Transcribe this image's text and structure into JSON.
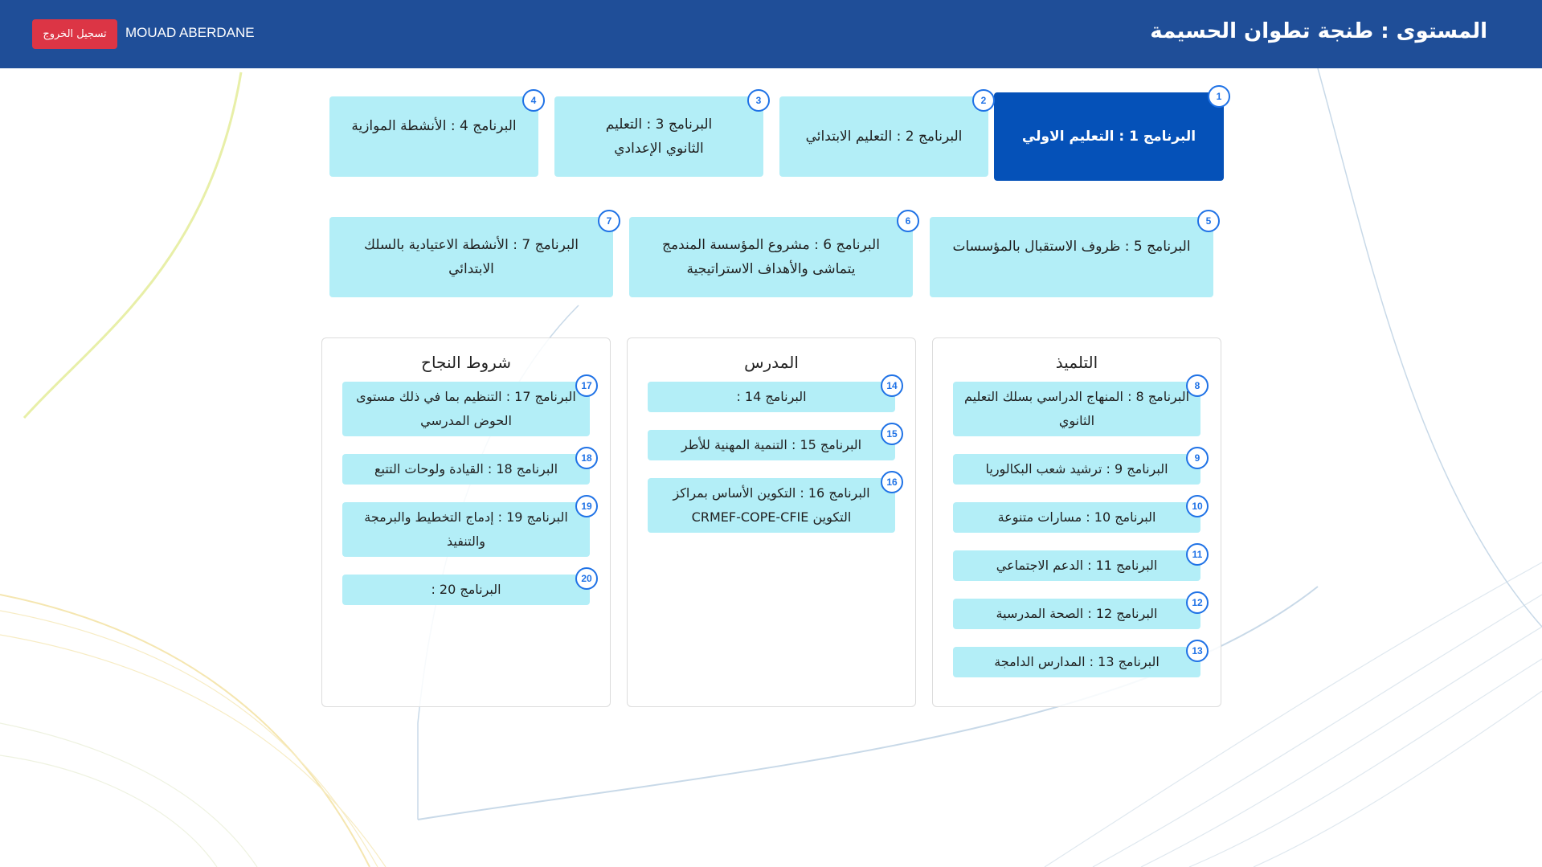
{
  "header": {
    "title": "المستوى : طنجة تطوان الحسيمة",
    "username": "MOUAD ABERDANE",
    "logout_label": "تسجيل الخروج"
  },
  "colors": {
    "header_bg": "#1f4e98",
    "card_bg": "#b3eef7",
    "active_card_bg": "#0551b8",
    "badge_border": "#1f72e6",
    "logout_bg": "#dc3545"
  },
  "top_programs": [
    {
      "num": "1",
      "label": "البرنامج 1 : التعليم الاولي",
      "active": true
    },
    {
      "num": "2",
      "label": "البرنامج 2 : التعليم الابتدائي"
    },
    {
      "num": "3",
      "label": "البرنامج 3 : التعليم الثانوي الإعدادي"
    },
    {
      "num": "4",
      "label": "البرنامج 4 : الأنشطة الموازية"
    },
    {
      "num": "5",
      "label": "البرنامج 5 : ظروف الاستقبال بالمؤسسات"
    },
    {
      "num": "6",
      "label": "البرنامج 6 : مشروع المؤسسة المندمج يتماشى والأهداف الاستراتيجية"
    },
    {
      "num": "7",
      "label": "البرنامج 7 : الأنشطة الاعتيادية بالسلك الابتدائي"
    }
  ],
  "panels": {
    "student": {
      "title": "التلميذ",
      "items": [
        {
          "num": "8",
          "label": "البرنامج 8 : المنهاج الدراسي بسلك التعليم الثانوي"
        },
        {
          "num": "9",
          "label": "البرنامج 9 : ترشيد شعب البكالوريا"
        },
        {
          "num": "10",
          "label": "البرنامج 10 : مسارات متنوعة"
        },
        {
          "num": "11",
          "label": "البرنامج 11 : الدعم الاجتماعي"
        },
        {
          "num": "12",
          "label": "البرنامج 12 : الصحة المدرسية"
        },
        {
          "num": "13",
          "label": "البرنامج 13 : المدارس الدامجة"
        }
      ]
    },
    "teacher": {
      "title": "المدرس",
      "items": [
        {
          "num": "14",
          "label": "البرنامج 14 :"
        },
        {
          "num": "15",
          "label": "البرنامج 15 : التنمية المهنية للأطر"
        },
        {
          "num": "16",
          "label": "البرنامج 16 : التكوين الأساس بمراكز التكوين  CRMEF-COPE-CFIE"
        }
      ]
    },
    "success": {
      "title": "شروط النجاح",
      "items": [
        {
          "num": "17",
          "label": "البرنامج 17 : التنظيم بما في ذلك مستوى الحوض المدرسي"
        },
        {
          "num": "18",
          "label": "البرنامج 18 : القيادة ولوحات التتبع"
        },
        {
          "num": "19",
          "label": "البرنامج 19 : إدماج التخطيط والبرمجة والتنفيذ"
        },
        {
          "num": "20",
          "label": "البرنامج 20 :"
        }
      ]
    }
  }
}
